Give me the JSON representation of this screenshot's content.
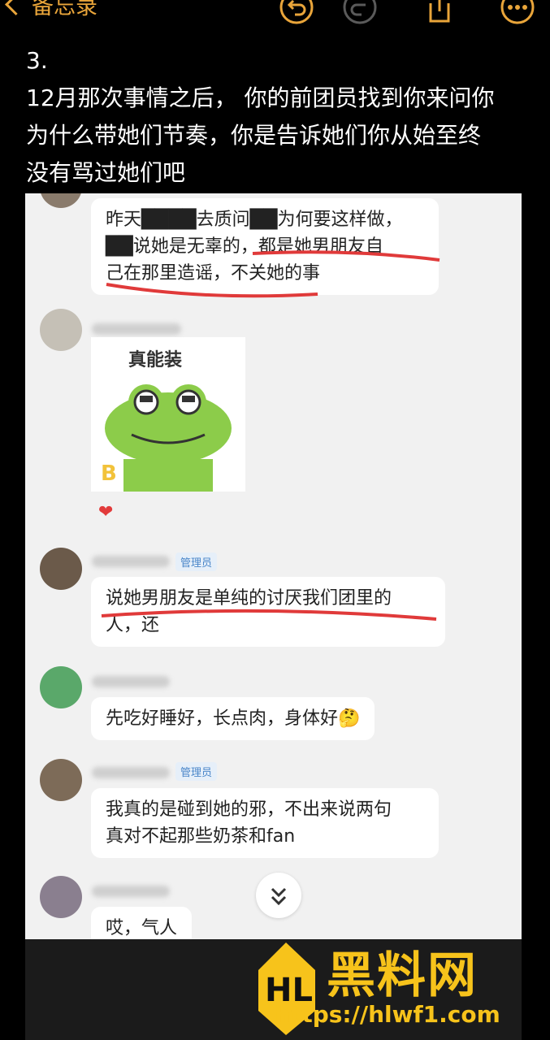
{
  "nav": {
    "back_label": "备忘录"
  },
  "note": {
    "lines": [
      "3.",
      "12月那次事情之后， 你的前团员找到你来问你",
      "为什么带她们节奏，你是告诉她们你从始至终",
      "没有骂过她们吧"
    ]
  },
  "chat": {
    "messages": [
      {
        "text_lines": [
          "昨天████去质问██为何要这样做，",
          "██说她是无辜的，都是她男朋友自",
          "己在那里造谣，不关她的事"
        ]
      },
      {
        "sticker_caption": "真能装"
      },
      {
        "admin_badge": "管理员",
        "text_lines": [
          "说她男朋友是单纯的讨厌我们团里的",
          "人，还"
        ]
      },
      {
        "text_lines": [
          "先吃好睡好，长点肉，身体好🤔"
        ]
      },
      {
        "admin_badge": "管理员",
        "text_lines": [
          "我真的是碰到她的邪，不出来说两句",
          "真对不起那些奶茶和fan"
        ]
      },
      {
        "text_lines": [
          "哎，气人"
        ]
      }
    ]
  },
  "watermark": {
    "brand": "黑料网",
    "url": "https://hlwf1.com"
  },
  "colors": {
    "accent": "#e9a53a",
    "brand": "#f7c31b",
    "underline": "#e03a3a"
  }
}
